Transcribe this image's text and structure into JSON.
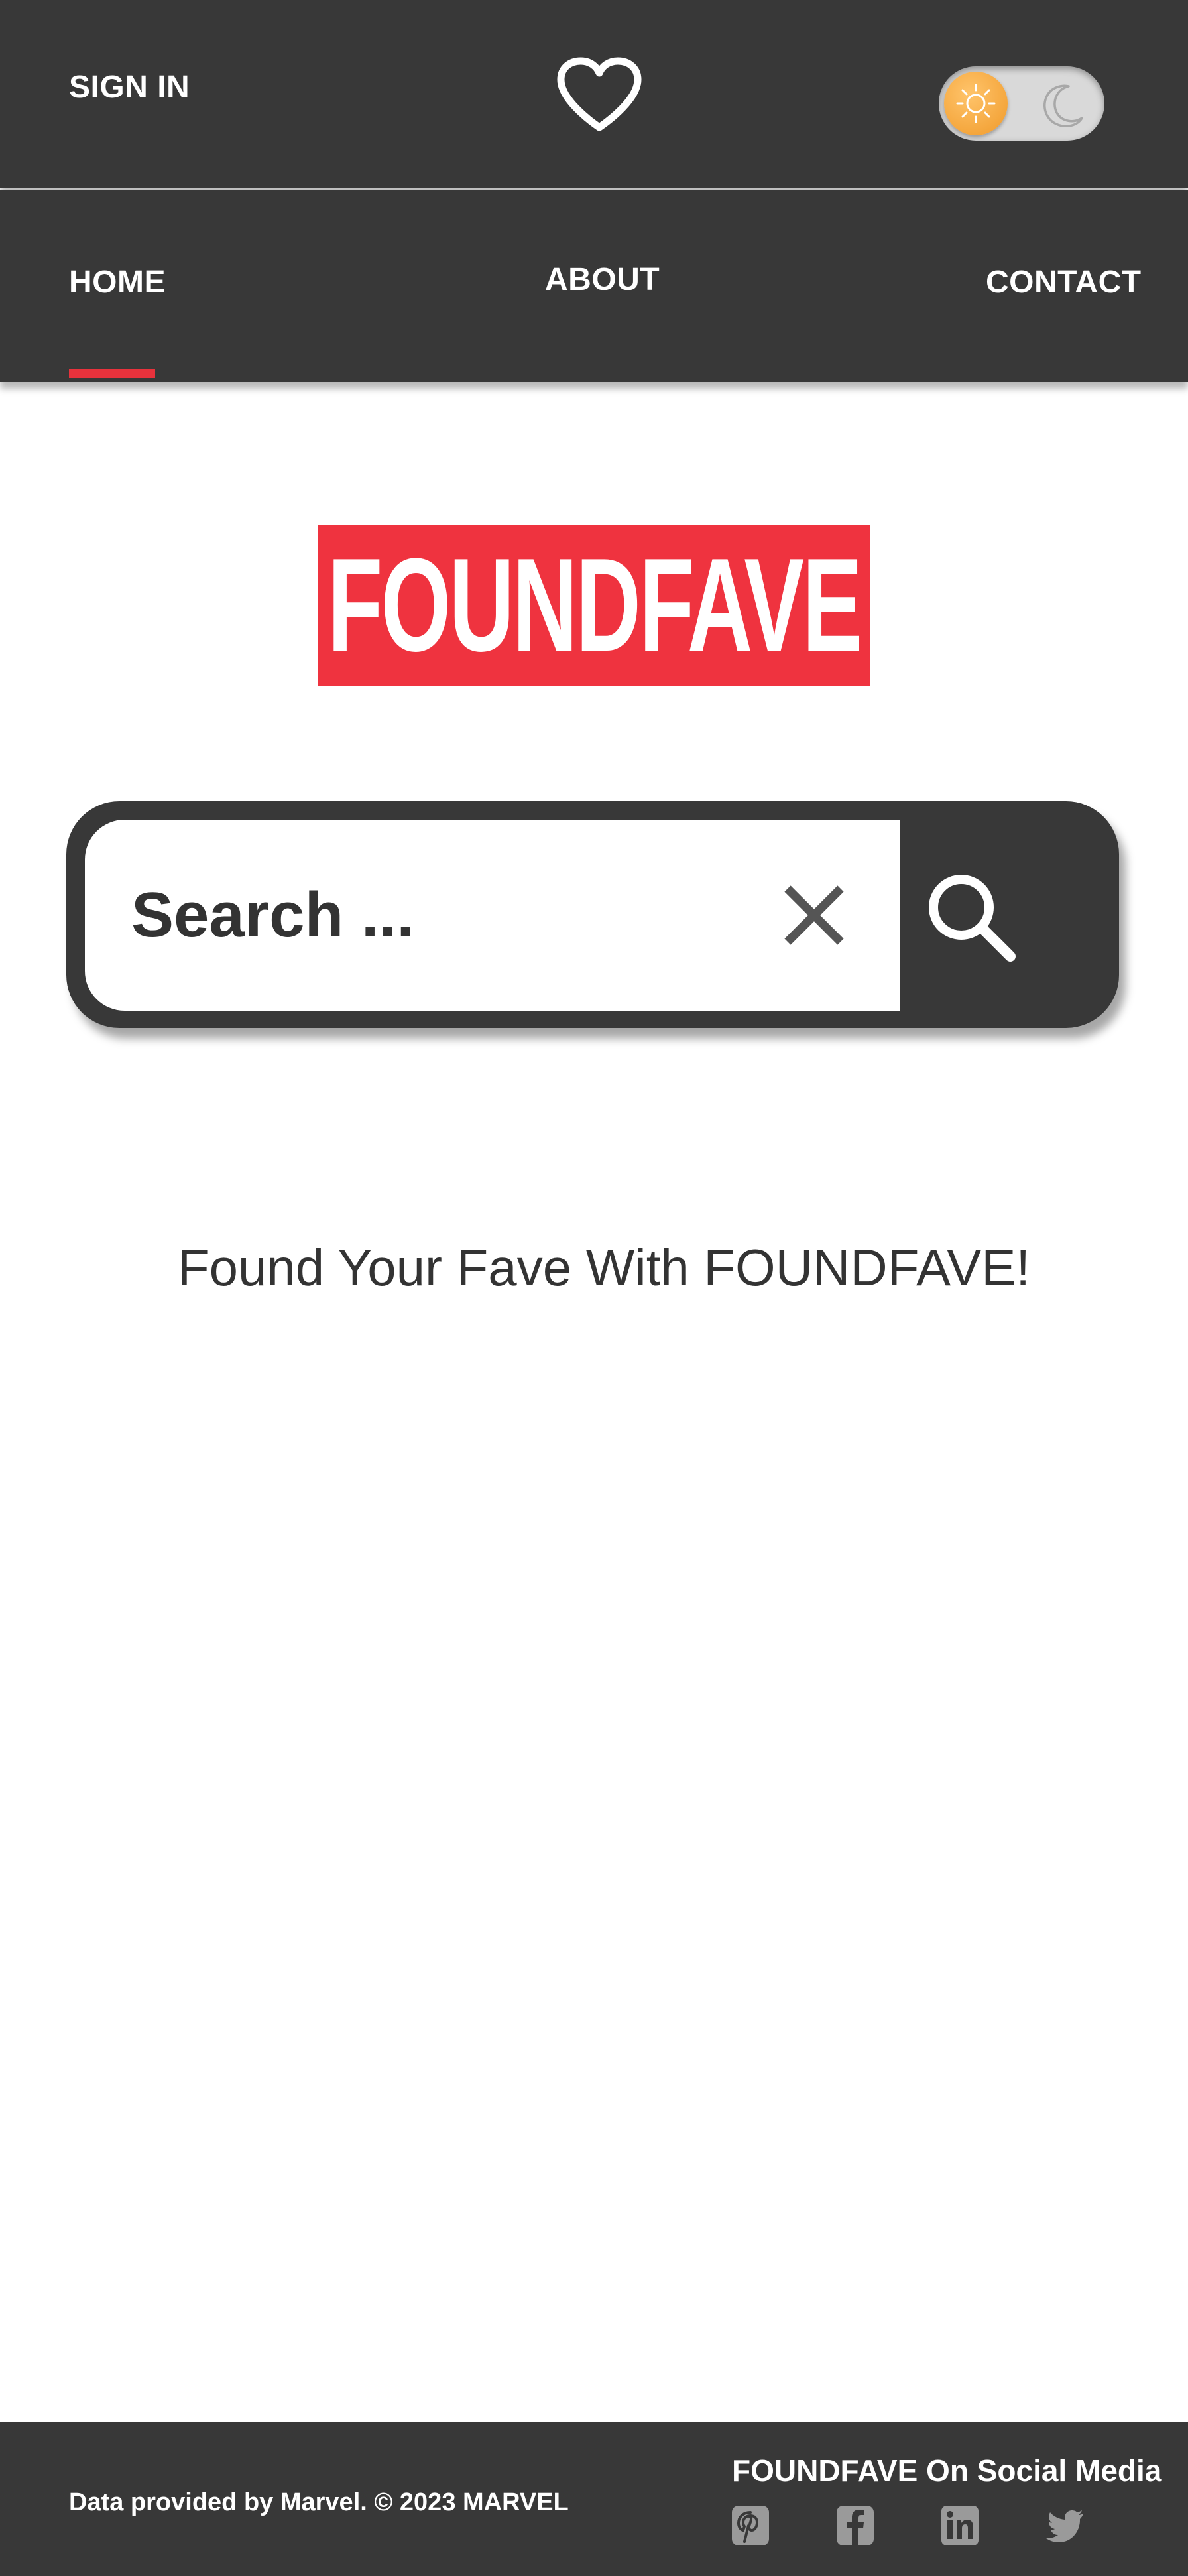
{
  "header": {
    "sign_in_label": "SIGN IN",
    "favorites_icon": "heart-icon",
    "theme_toggle": {
      "state": "light",
      "sun_icon": "sun-icon",
      "moon_icon": "moon-icon"
    }
  },
  "nav": {
    "items": [
      {
        "label": "HOME",
        "active": true
      },
      {
        "label": "ABOUT",
        "active": false
      },
      {
        "label": "CONTACT",
        "active": false
      }
    ]
  },
  "logo": {
    "text": "FOUNDFAVE"
  },
  "search": {
    "placeholder": "Search ...",
    "value": "",
    "clear_icon": "close-icon",
    "submit_icon": "search-icon"
  },
  "tagline": "Found Your Fave With FOUNDFAVE!",
  "footer": {
    "credit": "Data provided by Marvel. © 2023 MARVEL",
    "social_title": "FOUNDFAVE On Social Media",
    "social_icons": [
      "pinterest-icon",
      "facebook-icon",
      "linkedin-icon",
      "twitter-icon"
    ]
  },
  "colors": {
    "bar_background": "#383838",
    "accent_red": "#ef333f",
    "text_dark": "#333333",
    "sun_orange": "#f09a2a"
  }
}
